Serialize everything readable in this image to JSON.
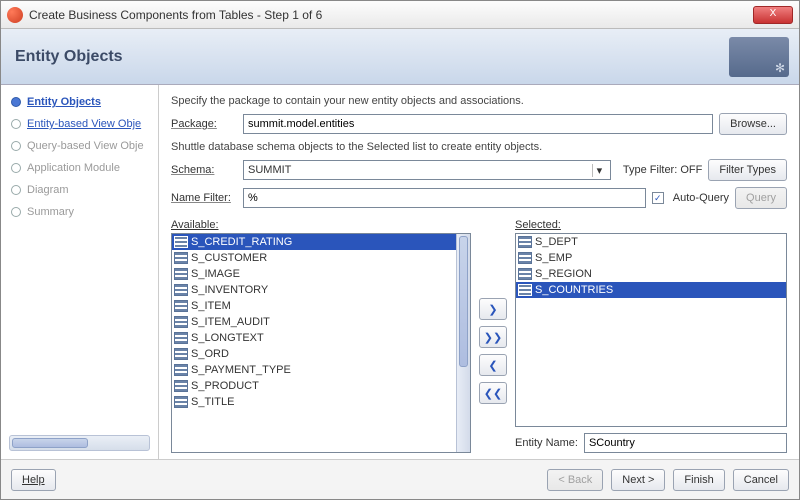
{
  "titlebar": {
    "title": "Create Business Components from Tables - Step 1 of 6",
    "close": "X"
  },
  "header": {
    "title": "Entity Objects"
  },
  "steps": [
    {
      "label": "Entity Objects",
      "state": "active",
      "name": "step-entity-objects"
    },
    {
      "label": "Entity-based View Obje",
      "state": "link",
      "name": "step-entity-based-view-objects"
    },
    {
      "label": "Query-based View Obje",
      "state": "disabled",
      "name": "step-query-based-view-objects"
    },
    {
      "label": "Application Module",
      "state": "disabled",
      "name": "step-application-module"
    },
    {
      "label": "Diagram",
      "state": "disabled",
      "name": "step-diagram"
    },
    {
      "label": "Summary",
      "state": "disabled",
      "name": "step-summary"
    }
  ],
  "main": {
    "instr1": "Specify the package to contain your new entity objects and associations.",
    "package_label": "Package:",
    "package_value": "summit.model.entities",
    "browse_label": "Browse...",
    "instr2": "Shuttle database schema objects to the Selected list to create entity objects.",
    "schema_label": "Schema:",
    "schema_value": "SUMMIT",
    "type_filter_label": "Type Filter: OFF",
    "filter_types_label": "Filter Types",
    "name_filter_label": "Name Filter:",
    "name_filter_value": "%",
    "auto_query_label": "Auto-Query",
    "auto_query_checked": "✓",
    "query_label": "Query",
    "available_label": "Available:",
    "selected_label": "Selected:",
    "entity_name_label": "Entity Name:",
    "entity_name_value": "SCountry"
  },
  "available": [
    {
      "label": "S_CREDIT_RATING",
      "selected": true
    },
    {
      "label": "S_CUSTOMER",
      "selected": false
    },
    {
      "label": "S_IMAGE",
      "selected": false
    },
    {
      "label": "S_INVENTORY",
      "selected": false
    },
    {
      "label": "S_ITEM",
      "selected": false
    },
    {
      "label": "S_ITEM_AUDIT",
      "selected": false
    },
    {
      "label": "S_LONGTEXT",
      "selected": false
    },
    {
      "label": "S_ORD",
      "selected": false
    },
    {
      "label": "S_PAYMENT_TYPE",
      "selected": false
    },
    {
      "label": "S_PRODUCT",
      "selected": false
    },
    {
      "label": "S_TITLE",
      "selected": false
    }
  ],
  "selected": [
    {
      "label": "S_DEPT",
      "selected": false
    },
    {
      "label": "S_EMP",
      "selected": false
    },
    {
      "label": "S_REGION",
      "selected": false
    },
    {
      "label": "S_COUNTRIES",
      "selected": true
    }
  ],
  "shuttle_buttons": {
    "move_right": "≫",
    "move_all_right": "⨠",
    "move_left": "≪",
    "move_all_left": "⨟"
  },
  "footer": {
    "help": "Help",
    "back": "< Back",
    "next": "Next >",
    "finish": "Finish",
    "cancel": "Cancel"
  }
}
